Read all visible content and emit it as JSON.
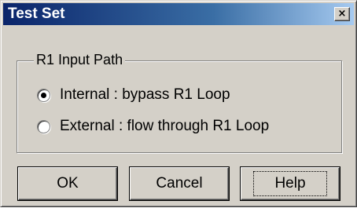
{
  "window": {
    "title": "Test Set",
    "close_symbol": "×",
    "close_icon": "close-icon"
  },
  "group": {
    "legend": "R1 Input Path",
    "options": [
      {
        "label": "Internal  : bypass R1 Loop",
        "selected": true
      },
      {
        "label": "External : flow through R1 Loop",
        "selected": false
      }
    ]
  },
  "buttons": {
    "ok": "OK",
    "cancel": "Cancel",
    "help": "Help",
    "focused": "help"
  },
  "colors": {
    "face": "#d4d0c8",
    "title_start": "#0a246a",
    "title_end": "#a6caf0",
    "title_text": "#ffffff"
  }
}
